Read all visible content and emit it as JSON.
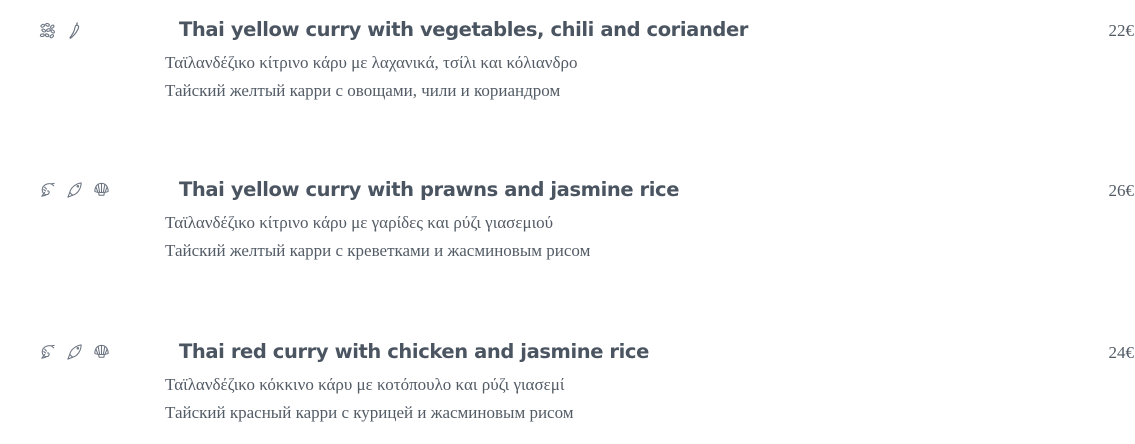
{
  "menu": {
    "dishes": [
      {
        "title": "Thai yellow curry with vegetables, chili and coriander",
        "greek": "Ταϊλανδέζικο κίτρινο κάρυ με λαχανικά, τσίλι και κόλιανδρο",
        "russian": "Тайский желтый карри с овощами, чили и кориандром",
        "price": "22€",
        "allergens": [
          "sesame-icon",
          "chili-icon"
        ]
      },
      {
        "title": "Thai yellow curry with prawns and jasmine rice",
        "greek": "Ταϊλανδέζικο κίτρινο κάρυ με γαρίδες και ρύζι γιασεμιού",
        "russian": "Тайский желтый карри с креветками и жасминовым рисом",
        "price": "26€",
        "allergens": [
          "shrimp-icon",
          "fish-icon",
          "shellfish-icon"
        ]
      },
      {
        "title": "Thai red curry with chicken and jasmine rice",
        "greek": "Ταϊλανδέζικο κόκκινο κάρυ με κοτόπουλο και ρύζι γιασεμί",
        "russian": "Тайский красный карри с курицей и жасминовым рисом",
        "price": "24€",
        "allergens": [
          "shrimp-icon",
          "fish-icon",
          "shellfish-icon"
        ]
      }
    ]
  },
  "colors": {
    "text": "#4b5561",
    "icon": "#6a7380",
    "background": "#ffffff"
  }
}
